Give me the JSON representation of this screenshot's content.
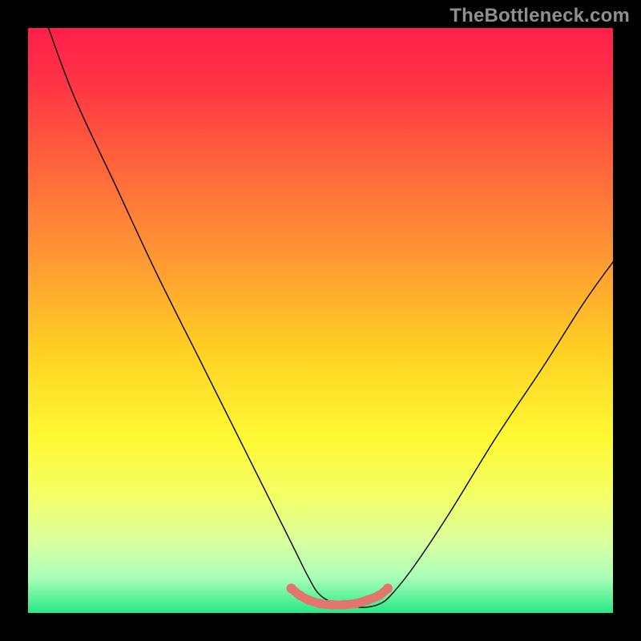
{
  "watermark": "TheBottleneck.com",
  "chart_data": {
    "type": "line",
    "title": "",
    "xlabel": "",
    "ylabel": "",
    "xlim": [
      0,
      100
    ],
    "ylim": [
      0,
      100
    ],
    "grid": false,
    "legend": false,
    "background_gradient": {
      "stops": [
        {
          "offset": 0.0,
          "color": "#ff1f4b"
        },
        {
          "offset": 0.1,
          "color": "#ff3545"
        },
        {
          "offset": 0.25,
          "color": "#ff6a3a"
        },
        {
          "offset": 0.4,
          "color": "#ff9a33"
        },
        {
          "offset": 0.55,
          "color": "#ffd023"
        },
        {
          "offset": 0.7,
          "color": "#fff933"
        },
        {
          "offset": 0.8,
          "color": "#f4ff66"
        },
        {
          "offset": 0.88,
          "color": "#d9ffa0"
        },
        {
          "offset": 0.94,
          "color": "#a8ffb8"
        },
        {
          "offset": 1.0,
          "color": "#27e885"
        }
      ]
    },
    "series": [
      {
        "name": "bottleneck-curve",
        "stroke": "#000000",
        "stroke_width": 1.4,
        "x": [
          3.5,
          8,
          15,
          22,
          30,
          38,
          45,
          48,
          50,
          53,
          56,
          58,
          60,
          62,
          66,
          72,
          80,
          88,
          95,
          100
        ],
        "y": [
          100,
          88,
          73,
          58,
          42,
          26,
          12,
          6,
          3,
          1.5,
          1,
          1,
          1.5,
          3,
          8,
          17,
          30,
          42,
          53,
          60
        ]
      },
      {
        "name": "highlight-dots",
        "type": "scatter",
        "fill": "#e2756d",
        "radius": 6,
        "x": [
          45.0,
          46.5,
          48.0,
          50.0,
          52.0,
          54.0,
          56.0,
          58.0,
          60.0,
          61.5
        ],
        "y": [
          4.2,
          3.0,
          2.2,
          1.6,
          1.4,
          1.4,
          1.6,
          2.2,
          3.0,
          4.2
        ]
      },
      {
        "name": "highlight-band",
        "type": "line",
        "stroke": "#e2756d",
        "stroke_width": 11,
        "x": [
          45.0,
          46.5,
          48.0,
          50.0,
          52.0,
          54.0,
          56.0,
          58.0,
          60.0,
          61.5
        ],
        "y": [
          4.2,
          3.0,
          2.2,
          1.6,
          1.4,
          1.4,
          1.6,
          2.2,
          3.0,
          4.2
        ]
      }
    ]
  }
}
